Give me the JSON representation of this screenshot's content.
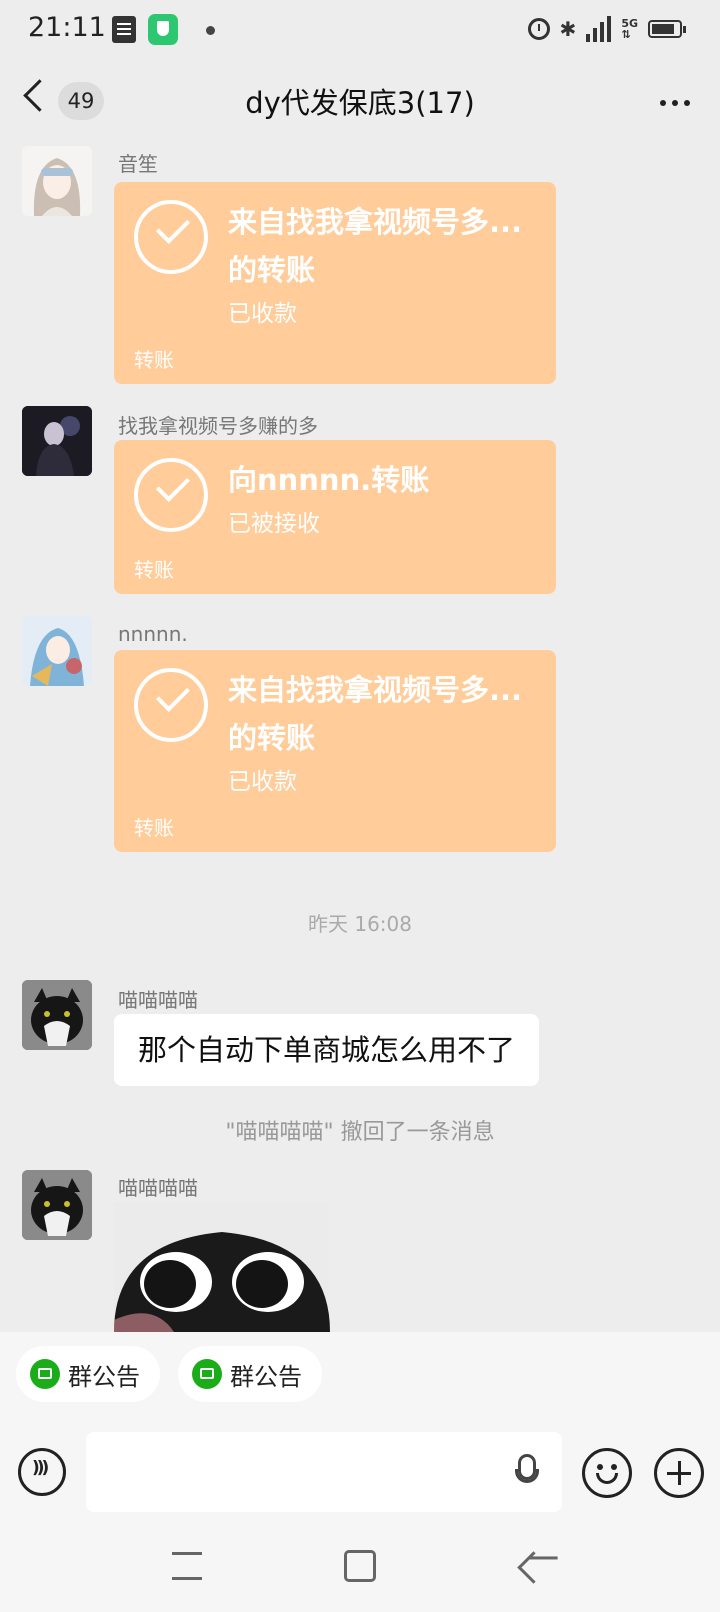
{
  "status_bar": {
    "time": "21:11"
  },
  "header": {
    "unread_count": "49",
    "title": "dy代发保底3(17)"
  },
  "messages": [
    {
      "sender": "音笙",
      "title": "来自找我拿视频号多...的转账",
      "status": "已收款",
      "footer": "转账"
    },
    {
      "sender": "找我拿视频号多赚的多",
      "title": "向nnnnn.转账",
      "status": "已被接收",
      "footer": "转账"
    },
    {
      "sender": "nnnnn.",
      "title": "来自找我拿视频号多...的转账",
      "status": "已收款",
      "footer": "转账"
    }
  ],
  "timestamp": "昨天 16:08",
  "text_message": {
    "sender": "喵喵喵喵",
    "text": "那个自动下单商城怎么用不了"
  },
  "system_message": "\"喵喵喵喵\" 撤回了一条消息",
  "image_message": {
    "sender": "喵喵喵喵"
  },
  "notices": [
    {
      "label": "群公告"
    },
    {
      "label": "群公告"
    }
  ],
  "colors": {
    "transfer_bg": "#ffcc9a",
    "accent_green": "#1aad19",
    "background": "#ededed"
  }
}
